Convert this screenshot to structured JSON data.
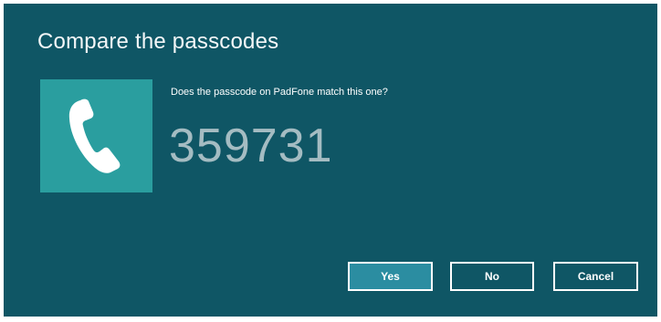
{
  "dialog": {
    "title": "Compare the passcodes",
    "question": "Does the passcode on PadFone match this one?",
    "passcode": "359731",
    "icon": "phone-icon"
  },
  "buttons": {
    "yes_label": "Yes",
    "no_label": "No",
    "cancel_label": "Cancel"
  },
  "colors": {
    "background": "#0f5665",
    "tile": "#2a9e9f",
    "passcode_text": "#a4bcc2",
    "primary_button": "#2b8da1"
  }
}
